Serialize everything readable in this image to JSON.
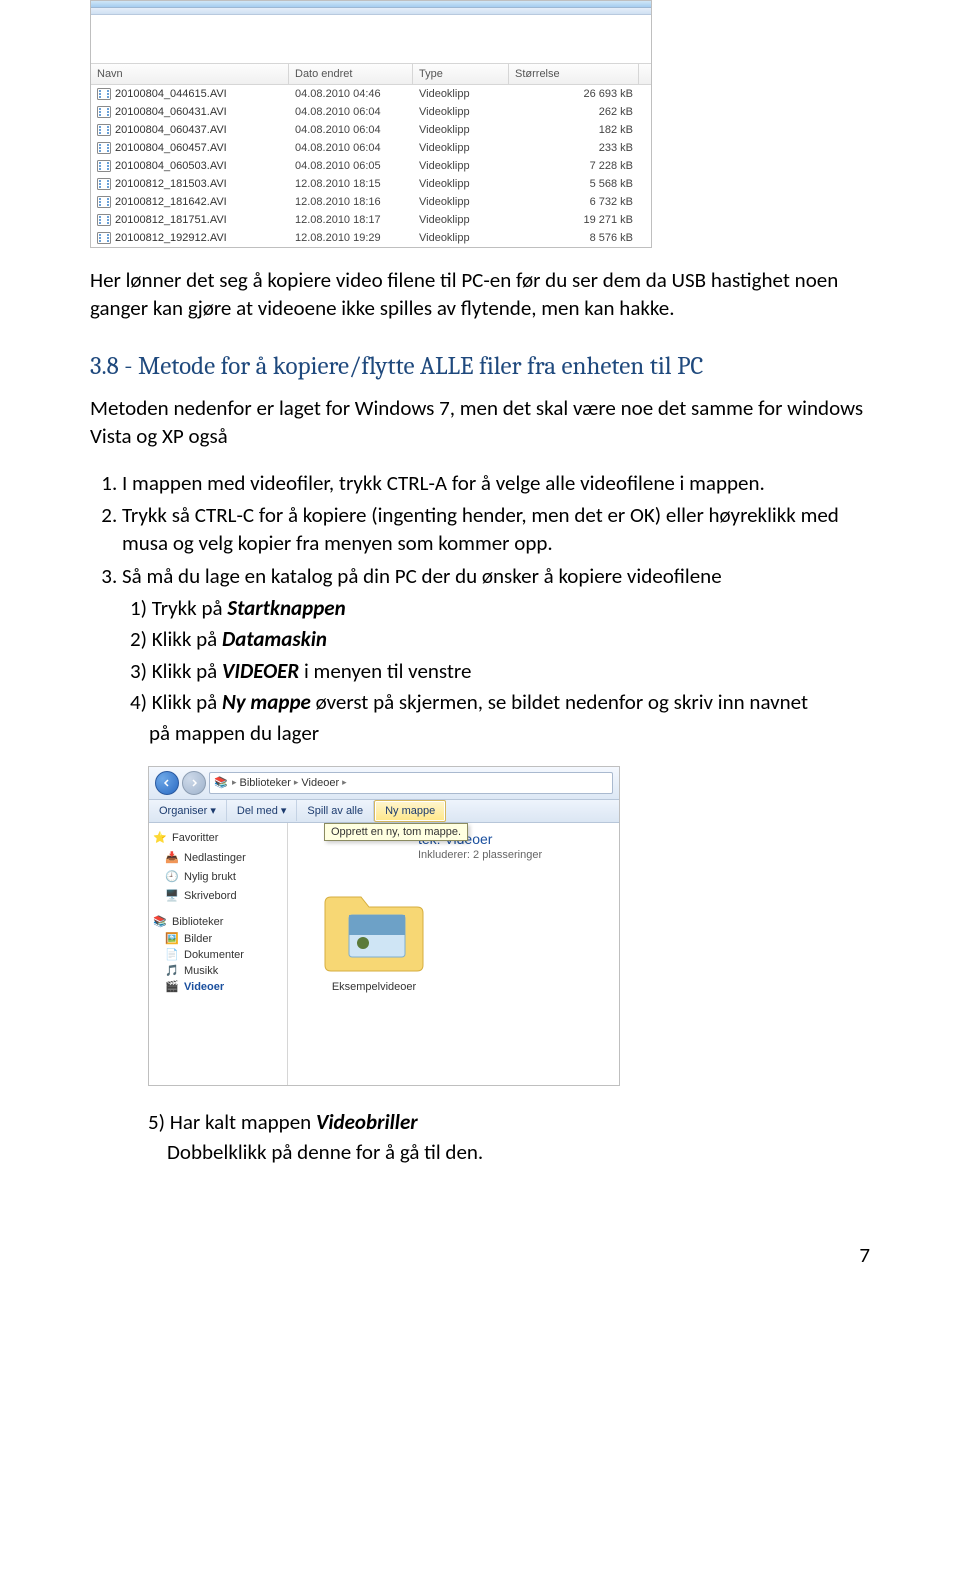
{
  "explorer1": {
    "columns": {
      "name": "Navn",
      "date": "Dato endret",
      "type": "Type",
      "size": "Størrelse"
    },
    "rows": [
      {
        "name": "20100804_044615.AVI",
        "date": "04.08.2010 04:46",
        "type": "Videoklipp",
        "size": "26 693 kB"
      },
      {
        "name": "20100804_060431.AVI",
        "date": "04.08.2010 06:04",
        "type": "Videoklipp",
        "size": "262 kB"
      },
      {
        "name": "20100804_060437.AVI",
        "date": "04.08.2010 06:04",
        "type": "Videoklipp",
        "size": "182 kB"
      },
      {
        "name": "20100804_060457.AVI",
        "date": "04.08.2010 06:04",
        "type": "Videoklipp",
        "size": "233 kB"
      },
      {
        "name": "20100804_060503.AVI",
        "date": "04.08.2010 06:05",
        "type": "Videoklipp",
        "size": "7 228 kB"
      },
      {
        "name": "20100812_181503.AVI",
        "date": "12.08.2010 18:15",
        "type": "Videoklipp",
        "size": "5 568 kB"
      },
      {
        "name": "20100812_181642.AVI",
        "date": "12.08.2010 18:16",
        "type": "Videoklipp",
        "size": "6 732 kB"
      },
      {
        "name": "20100812_181751.AVI",
        "date": "12.08.2010 18:17",
        "type": "Videoklipp",
        "size": "19 271 kB"
      },
      {
        "name": "20100812_192912.AVI",
        "date": "12.08.2010 19:29",
        "type": "Videoklipp",
        "size": "8 576 kB"
      }
    ]
  },
  "para1": "Her lønner det seg å kopiere video filene til PC-en før du ser dem da USB hastighet noen ganger kan gjøre at videoene ikke spilles av flytende, men kan hakke.",
  "heading1": "3.8 - Metode for å kopiere/flytte ALLE filer fra enheten til PC",
  "para2": "Metoden nedenfor er laget for Windows 7, men det skal være noe det samme for windows Vista og XP også",
  "li1": "I mappen med videofiler, trykk CTRL-A for å velge alle videofilene i mappen.",
  "li2": "Trykk så CTRL-C for å kopiere (ingenting hender, men det er OK) eller høyreklikk med musa og velg kopier fra menyen som kommer opp.",
  "li3": "Så må du lage en katalog på din PC der du ønsker å kopiere videofilene",
  "sub1_pre": "1) Trykk på ",
  "sub1_b": "Startknappen",
  "sub2_pre": "2) Klikk på ",
  "sub2_b": "Datamaskin",
  "sub3_pre": "3) Klikk på ",
  "sub3_b": "VIDEOER",
  "sub3_post": " i menyen til venstre",
  "sub4_pre": "4) Klikk på ",
  "sub4_b": "Ny mappe",
  "sub4_post_a": " øverst på skjermen, se bildet nedenfor og skriv inn navnet",
  "sub4_post_b": "    på mappen du lager",
  "explorer2": {
    "crumb1": "Biblioteker",
    "crumb2": "Videoer",
    "toolbar": {
      "org": "Organiser ▾",
      "share": "Del med ▾",
      "play": "Spill av alle",
      "newf": "Ny mappe"
    },
    "tooltip": "Opprett en ny, tom mappe.",
    "title_suffix": "tek: Videoer",
    "subtitle": "Inkluderer: 2 plasseringer",
    "side": {
      "fav": "Favoritter",
      "down": "Nedlastinger",
      "recent": "Nylig brukt",
      "desk": "Skrivebord",
      "lib": "Biblioteker",
      "pics": "Bilder",
      "docs": "Dokumenter",
      "music": "Musikk",
      "videos": "Videoer"
    },
    "folder_caption": "Eksempelvideoer"
  },
  "sub5_pre": "5) Har kalt mappen ",
  "sub5_b": "Videobriller",
  "sub5b": "    Dobbelklikk på denne for å gå til den.",
  "pagenum": "7"
}
